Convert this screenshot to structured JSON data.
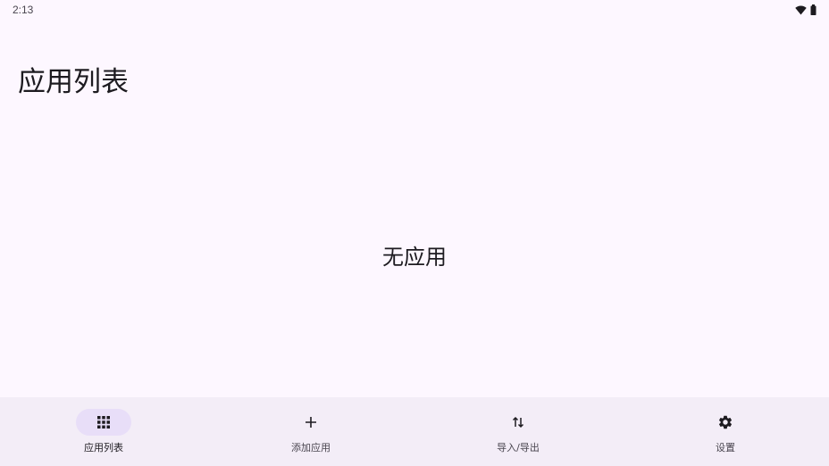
{
  "status_bar": {
    "time": "2:13",
    "icons": [
      "wifi-icon",
      "battery-icon"
    ]
  },
  "page": {
    "title": "应用列表",
    "empty_message": "无应用"
  },
  "bottom_nav": {
    "items": [
      {
        "label": "应用列表",
        "icon": "apps-grid-icon",
        "active": true
      },
      {
        "label": "添加应用",
        "icon": "add-icon",
        "active": false
      },
      {
        "label": "导入/导出",
        "icon": "import-export-icon",
        "active": false
      },
      {
        "label": "设置",
        "icon": "gear-icon",
        "active": false
      }
    ]
  },
  "colors": {
    "background": "#fdf7ff",
    "nav_background": "#f3edf7",
    "active_indicator": "#e8def8",
    "text": "#1d1b20"
  }
}
